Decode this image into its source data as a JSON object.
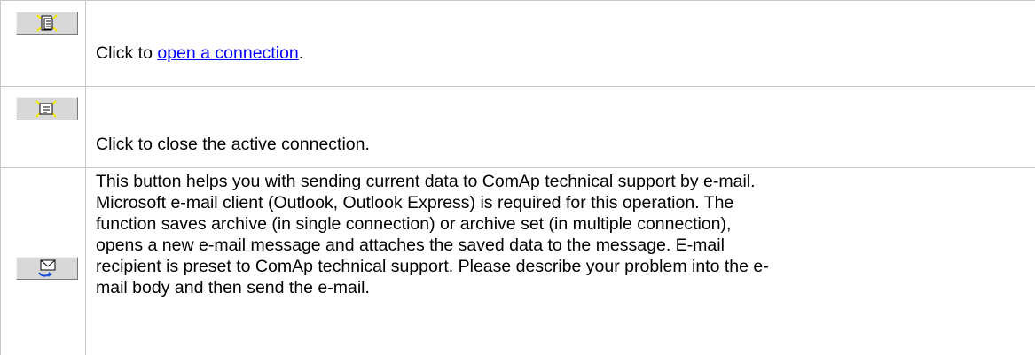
{
  "rows": [
    {
      "icon": "open-connection-icon",
      "prefix": "Click to ",
      "link": "open a connection",
      "suffix": "."
    },
    {
      "icon": "close-connection-icon",
      "text": "Click to close the active connection."
    },
    {
      "icon": "send-email-icon",
      "lines": [
        "This button helps you with sending current data to ComAp technical support by e-mail.",
        "Microsoft e-mail client (Outlook, Outlook Express) is required for this operation. The",
        "function saves archive (in single connection) or archive set (in multiple connection),",
        "opens a new e-mail message and attaches the saved data to the message. E-mail",
        "recipient is preset to ComAp technical support. Please describe your problem into the e-",
        "mail body and then send the e-mail."
      ]
    }
  ],
  "colors": {
    "border": "#c8c8c8",
    "link": "#0000ff",
    "button_face": "#d8d8d8",
    "icon_yellow": "#f5e600"
  }
}
